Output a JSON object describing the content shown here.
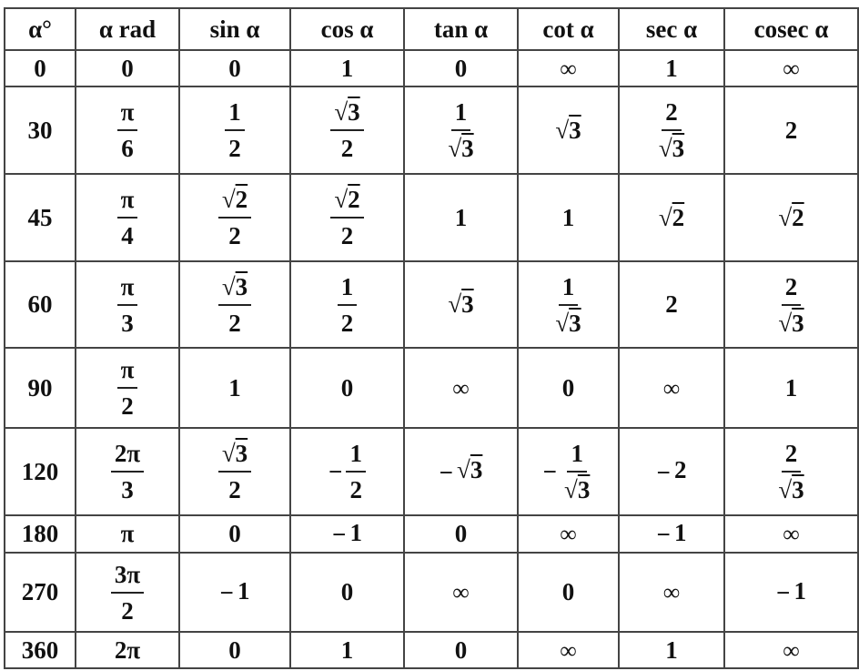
{
  "headers": [
    "α°",
    "α rad",
    "sin α",
    "cos α",
    "tan α",
    "cot α",
    "sec α",
    "cosec α"
  ],
  "rows": [
    [
      {
        "t": "0"
      },
      {
        "t": "0"
      },
      {
        "t": "0"
      },
      {
        "t": "1"
      },
      {
        "t": "0"
      },
      {
        "t": "∞"
      },
      {
        "t": "1"
      },
      {
        "t": "∞"
      }
    ],
    [
      {
        "t": "30"
      },
      {
        "n": "π",
        "d": "6"
      },
      {
        "n": "1",
        "d": "2"
      },
      {
        "n": "√3",
        "d": "2"
      },
      {
        "n": "1",
        "d": "√3"
      },
      {
        "t": "√3"
      },
      {
        "n": "2",
        "d": "√3"
      },
      {
        "t": "2"
      }
    ],
    [
      {
        "t": "45"
      },
      {
        "n": "π",
        "d": "4"
      },
      {
        "n": "√2",
        "d": "2"
      },
      {
        "n": "√2",
        "d": "2"
      },
      {
        "t": "1"
      },
      {
        "t": "1"
      },
      {
        "t": "√2"
      },
      {
        "t": "√2"
      }
    ],
    [
      {
        "t": "60"
      },
      {
        "n": "π",
        "d": "3"
      },
      {
        "n": "√3",
        "d": "2"
      },
      {
        "n": "1",
        "d": "2"
      },
      {
        "t": "√3"
      },
      {
        "n": "1",
        "d": "√3"
      },
      {
        "t": "2"
      },
      {
        "n": "2",
        "d": "√3"
      }
    ],
    [
      {
        "t": "90"
      },
      {
        "n": "π",
        "d": "2"
      },
      {
        "t": "1"
      },
      {
        "t": "0"
      },
      {
        "t": "∞"
      },
      {
        "t": "0"
      },
      {
        "t": "∞"
      },
      {
        "t": "1"
      }
    ],
    [
      {
        "t": "120"
      },
      {
        "n": "2π",
        "d": "3"
      },
      {
        "n": "√3",
        "d": "2"
      },
      {
        "s": "−",
        "n": "1",
        "d": "2"
      },
      {
        "s": "−",
        "t": "√3"
      },
      {
        "s": "−",
        "n": "1",
        "d": "√3"
      },
      {
        "s": "−",
        "t": "2"
      },
      {
        "n": "2",
        "d": "√3"
      }
    ],
    [
      {
        "t": "180"
      },
      {
        "t": "π"
      },
      {
        "t": "0"
      },
      {
        "s": "−",
        "t": "1"
      },
      {
        "t": "0"
      },
      {
        "t": "∞"
      },
      {
        "s": "−",
        "t": "1"
      },
      {
        "t": "∞"
      }
    ],
    [
      {
        "t": "270"
      },
      {
        "n": "3π",
        "d": "2"
      },
      {
        "s": "−",
        "t": "1"
      },
      {
        "t": "0"
      },
      {
        "t": "∞"
      },
      {
        "t": "0"
      },
      {
        "t": "∞"
      },
      {
        "s": "−",
        "t": "1"
      }
    ],
    [
      {
        "t": "360"
      },
      {
        "t": "2π"
      },
      {
        "t": "0"
      },
      {
        "t": "1"
      },
      {
        "t": "0"
      },
      {
        "t": "∞"
      },
      {
        "t": "1"
      },
      {
        "t": "∞"
      }
    ]
  ]
}
